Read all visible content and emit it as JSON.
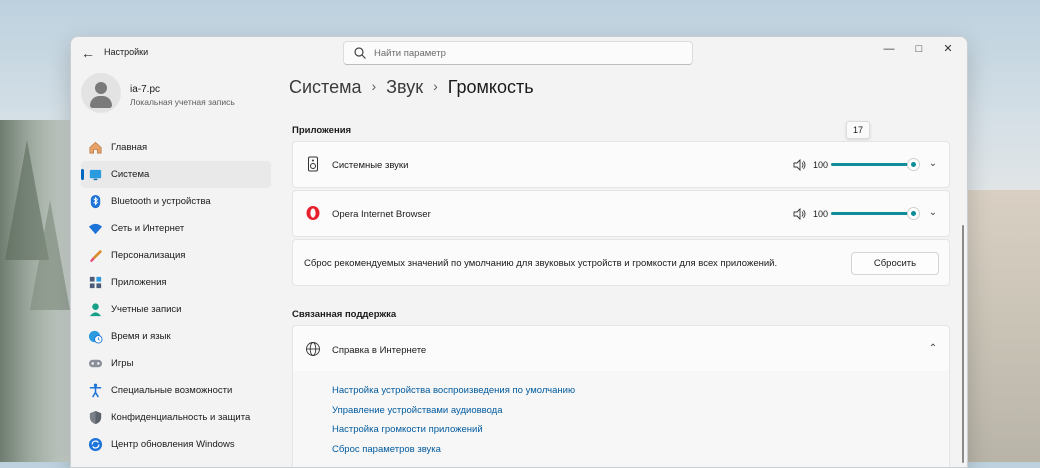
{
  "window": {
    "app_title": "Настройки",
    "search_placeholder": "Найти параметр"
  },
  "profile": {
    "name": "ia-7.pc",
    "subtitle": "Локальная учетная запись"
  },
  "sidebar": {
    "items": [
      {
        "label": "Главная",
        "icon": "home-icon"
      },
      {
        "label": "Система",
        "icon": "system-monitor-icon",
        "active": true
      },
      {
        "label": "Bluetooth и устройства",
        "icon": "bluetooth-icon"
      },
      {
        "label": "Сеть и Интернет",
        "icon": "wifi-icon"
      },
      {
        "label": "Персонализация",
        "icon": "brush-icon"
      },
      {
        "label": "Приложения",
        "icon": "apps-icon"
      },
      {
        "label": "Учетные записи",
        "icon": "user-icon"
      },
      {
        "label": "Время и язык",
        "icon": "globe-clock-icon"
      },
      {
        "label": "Игры",
        "icon": "gamepad-icon"
      },
      {
        "label": "Специальные возможности",
        "icon": "accessibility-icon"
      },
      {
        "label": "Конфиденциальность и защита",
        "icon": "shield-icon"
      },
      {
        "label": "Центр обновления Windows",
        "icon": "update-icon"
      }
    ]
  },
  "breadcrumb": {
    "level1": "Система",
    "level2": "Звук",
    "current": "Громкость"
  },
  "apps_section": {
    "title": "Приложения",
    "tooltip_value": "17",
    "apps": [
      {
        "name": "Системные звуки",
        "icon": "speaker-device-icon",
        "volume": 100
      },
      {
        "name": "Opera Internet Browser",
        "icon": "opera-logo-icon",
        "volume": 100
      }
    ],
    "reset_text": "Сброс рекомендуемых значений по умолчанию для звуковых устройств и громкости для всех приложений.",
    "reset_button": "Сбросить"
  },
  "support_section": {
    "title": "Связанная поддержка",
    "help_label": "Справка в Интернете",
    "links": [
      "Настройка устройства воспроизведения по умолчанию",
      "Управление устройствами аудиоввода",
      "Настройка громкости приложений",
      "Сброс параметров звука"
    ]
  },
  "colors": {
    "accent": "#0f8c99",
    "link": "#005a9e",
    "nav_indicator": "#0067c0"
  }
}
